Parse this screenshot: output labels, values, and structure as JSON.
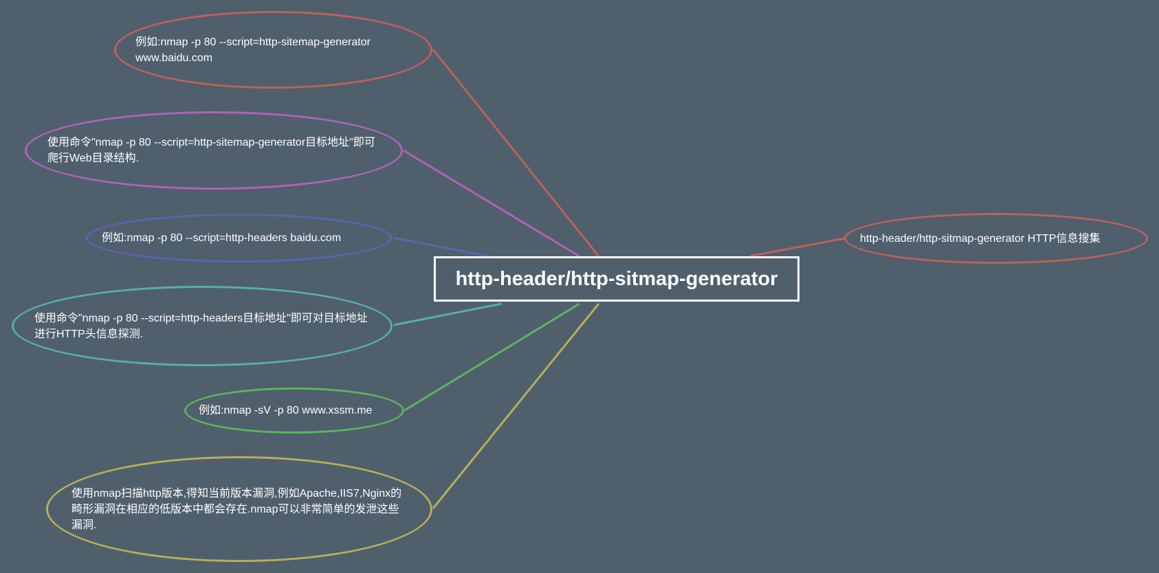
{
  "colors": {
    "background": "#505f6c",
    "center_border": "#ffffff",
    "text": "#ffffff",
    "red": "#c0605c",
    "purple": "#b062b8",
    "blue": "#5f62b4",
    "teal": "#56aeae",
    "green": "#5cb55c",
    "yellow": "#b5b058"
  },
  "center": {
    "label": "http-header/http-sitmap-generator"
  },
  "right_node": {
    "label": "http-header/http-sitmap-generator HTTP信息搜集"
  },
  "left_nodes": [
    {
      "label": "例如:nmap -p 80 --script=http-sitemap-generator www.baidu.com"
    },
    {
      "label": "使用命令\"nmap -p 80 --script=http-sitemap-generator目标地址\"即可爬行Web目录结构."
    },
    {
      "label": "例如:nmap -p 80 --script=http-headers baidu.com"
    },
    {
      "label": "使用命令\"nmap -p 80 --script=http-headers目标地址\"即可对目标地址进行HTTP头信息探测."
    },
    {
      "label": "例如:nmap -sV -p 80 www.xssm.me"
    },
    {
      "label": "使用nmap扫描http版本,得知当前版本漏洞,例如Apache,IIS7,Nginx的畸形漏洞在相应的低版本中都会存在.nmap可以非常简单的发泄这些漏洞."
    }
  ]
}
